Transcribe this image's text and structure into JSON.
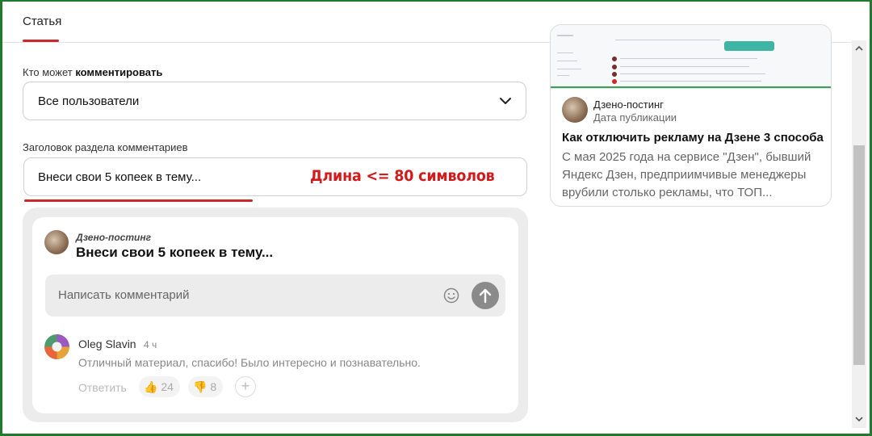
{
  "tabs": {
    "article": "Статья"
  },
  "settings": {
    "who_can_comment_label_prefix": "Кто может ",
    "who_can_comment_label_bold": "комментировать",
    "who_can_comment_value": "Все пользователи",
    "comments_header_label": "Заголовок раздела комментариев",
    "comments_header_value": "Внеси свои 5 копеек в тему...",
    "annotation": "Длина <= 80 символов"
  },
  "preview": {
    "channel": "Дзено-постинг",
    "title": "Внеси свои 5 копеек в тему...",
    "comment_placeholder": "Написать комментарий",
    "comment": {
      "author": "Oleg Slavin",
      "time": "4 ч",
      "text": "Отличный материал, спасибо! Было интересно и познавательно.",
      "reply_label": "Ответить",
      "likes": "24",
      "dislikes": "8",
      "add_reaction": "+"
    }
  },
  "card": {
    "channel": "Дзено-постинг",
    "date": "Дата публикации",
    "title": "Как отключить рекламу на Дзене 3 способа",
    "text": "С мая 2025 года на сервисе \"Дзен\", бывший Яндекс Дзен, предприимчивые менеджеры врубили столько рекламы, что ТОП..."
  },
  "colors": {
    "accent": "#c9282d",
    "annotation": "#d11a1a",
    "frame": "#1f7a2e"
  },
  "icons": [
    "chevron-down-icon",
    "smile-icon",
    "send-arrow-icon",
    "thumbs-up-icon",
    "thumbs-down-icon",
    "scroll-up-icon",
    "scroll-down-icon"
  ]
}
